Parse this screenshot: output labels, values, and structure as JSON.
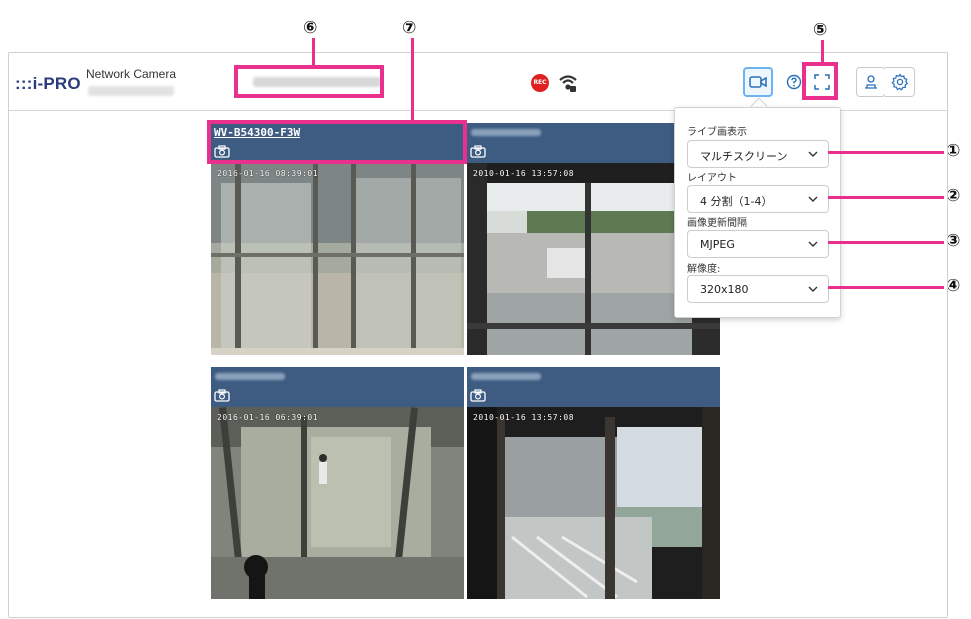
{
  "callouts": [
    "⑥",
    "⑦",
    "⑤",
    "①",
    "②",
    "③",
    "④"
  ],
  "header": {
    "logo_text": "i-PRO",
    "logo_dots": ":::",
    "model_label": "Network Camera",
    "rec_label": "REC"
  },
  "cameras": [
    {
      "name": "WV-B54300-F3W",
      "timestamp": "2016-01-16 08:39:01",
      "name_visible": true
    },
    {
      "name": "",
      "timestamp": "2010-01-16 13:57:08",
      "name_visible": false
    },
    {
      "name": "",
      "timestamp": "2016-01-16 06:39:01",
      "name_visible": false
    },
    {
      "name": "",
      "timestamp": "2010-01-16 13:57:08",
      "name_visible": false
    }
  ],
  "panel": {
    "live_view_label": "ライブ画表示",
    "live_view_value": "マルチスクリーン",
    "layout_label": "レイアウト",
    "layout_value": "4 分割（1-4）",
    "refresh_label": "画像更新間隔",
    "refresh_value": "MJPEG",
    "resolution_label": "解像度:",
    "resolution_value": "320x180"
  },
  "colors": {
    "accent": "#e8308c",
    "cam_header": "#3e5c82",
    "logo": "#2b3a7a",
    "rec": "#e02020",
    "active_button": "#6db3f2"
  }
}
